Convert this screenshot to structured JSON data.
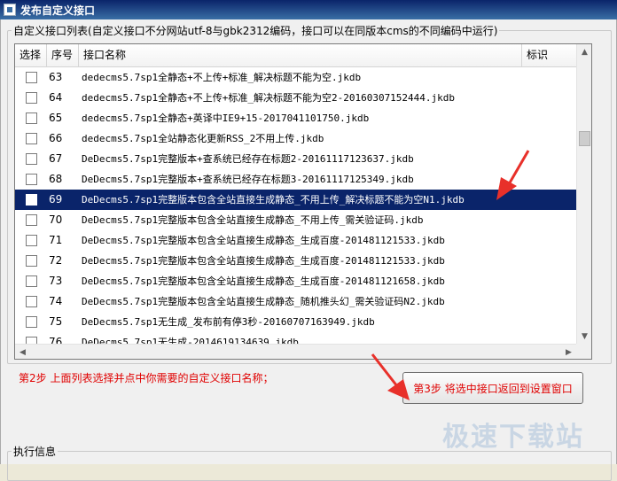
{
  "window": {
    "title": "发布自定义接口"
  },
  "list_group": {
    "legend": "自定义接口列表(自定义接口不分网站utf-8与gbk2312编码，接口可以在同版本cms的不同编码中运行)"
  },
  "columns": {
    "check": "选择",
    "num": "序号",
    "name": "接口名称",
    "tag": "标识"
  },
  "rows": [
    {
      "num": "63",
      "name": "dedecms5.7sp1全静态+不上传+标准_解决标题不能为空.jkdb",
      "selected": false
    },
    {
      "num": "64",
      "name": "dedecms5.7sp1全静态+不上传+标准_解决标题不能为空2-20160307152444.jkdb",
      "selected": false
    },
    {
      "num": "65",
      "name": "dedecms5.7sp1全静态+英译中IE9+15-2017041101750.jkdb",
      "selected": false
    },
    {
      "num": "66",
      "name": "dedecms5.7sp1全站静态化更新RSS_2不用上传.jkdb",
      "selected": false
    },
    {
      "num": "67",
      "name": "DeDecms5.7sp1完整版本+查系统已经存在标题2-20161117123637.jkdb",
      "selected": false
    },
    {
      "num": "68",
      "name": "DeDecms5.7sp1完整版本+查系统已经存在标题3-20161117125349.jkdb",
      "selected": false
    },
    {
      "num": "69",
      "name": "DeDecms5.7sp1完整版本包含全站直接生成静态_不用上传_解决标题不能为空N1.jkdb",
      "selected": true
    },
    {
      "num": "70",
      "name": "DeDecms5.7sp1完整版本包含全站直接生成静态_不用上传_需关验证码.jkdb",
      "selected": false
    },
    {
      "num": "71",
      "name": "DeDecms5.7sp1完整版本包含全站直接生成静态_生成百度-201481121533.jkdb",
      "selected": false
    },
    {
      "num": "72",
      "name": "DeDecms5.7sp1完整版本包含全站直接生成静态_生成百度-201481121533.jkdb",
      "selected": false
    },
    {
      "num": "73",
      "name": "DeDecms5.7sp1完整版本包含全站直接生成静态_生成百度-201481121658.jkdb",
      "selected": false
    },
    {
      "num": "74",
      "name": "DeDecms5.7sp1完整版本包含全站直接生成静态_随机推头幻_需关验证码N2.jkdb",
      "selected": false
    },
    {
      "num": "75",
      "name": "DeDecms5.7sp1无生成_发布前有停3秒-20160707163949.jkdb",
      "selected": false
    },
    {
      "num": "76",
      "name": "DeDecms5.7sp1无生成-2014619134639.jkdb",
      "selected": false
    }
  ],
  "hint": {
    "step2": "第2步 上面列表选择并点中你需要的自定义接口名称；"
  },
  "buttons": {
    "return_label": "第3步 将选中接口返回到设置窗口"
  },
  "log_group": {
    "legend": "执行信息"
  },
  "watermark": "极速下载站",
  "colors": {
    "selection": "#0a246a",
    "hint_red": "#e00000",
    "arrow_red": "#e8302a"
  }
}
